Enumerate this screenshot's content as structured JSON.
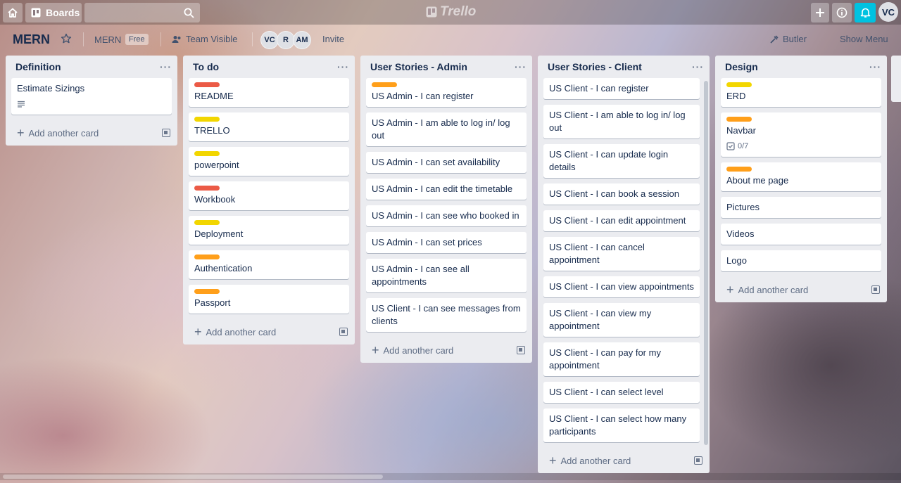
{
  "header": {
    "boards_label": "Boards",
    "logo_text": "Trello",
    "avatar_initials": "VC"
  },
  "board": {
    "title": "MERN",
    "team_name": "MERN",
    "plan_badge": "Free",
    "visibility": "Team Visible",
    "members": [
      "VC",
      "R",
      "AM"
    ],
    "invite_label": "Invite",
    "butler_label": "Butler",
    "show_menu_label": "Show Menu"
  },
  "labels": {
    "red": "#eb5a46",
    "yellow": "#f2d600",
    "orange": "#ff9f1a"
  },
  "add_card_label": "Add another card",
  "list_menu_glyph": "···",
  "lists": [
    {
      "title": "Definition",
      "cards": [
        {
          "text": "Estimate Sizings",
          "has_description": true
        }
      ]
    },
    {
      "title": "To do",
      "cards": [
        {
          "text": "README",
          "label": "red"
        },
        {
          "text": "TRELLO",
          "label": "yellow"
        },
        {
          "text": "powerpoint",
          "label": "yellow"
        },
        {
          "text": "Workbook",
          "label": "red"
        },
        {
          "text": "Deployment",
          "label": "yellow"
        },
        {
          "text": "Authentication",
          "label": "orange"
        },
        {
          "text": "Passport",
          "label": "orange"
        }
      ]
    },
    {
      "title": "User Stories - Admin",
      "cards": [
        {
          "text": "US Admin - I can register",
          "label": "orange"
        },
        {
          "text": "US Admin - I am able to log in/ log out"
        },
        {
          "text": "US Admin - I can set availability"
        },
        {
          "text": "US Admin - I can edit the timetable"
        },
        {
          "text": "US Admin - I can see who booked in"
        },
        {
          "text": "US Admin - I can set prices"
        },
        {
          "text": "US Admin - I can see all appointments"
        },
        {
          "text": "US Client - I can see messages from clients"
        }
      ]
    },
    {
      "title": "User Stories - Client",
      "cards": [
        {
          "text": "US Client - I can register"
        },
        {
          "text": "US Client - I am able to log in/ log out"
        },
        {
          "text": "US Client - I can update login details"
        },
        {
          "text": "US Client - I can book a session"
        },
        {
          "text": "US Client - I can edit appointment"
        },
        {
          "text": "US Client - I can cancel appointment"
        },
        {
          "text": "US Client - I can view appointments"
        },
        {
          "text": "US Client - I can view my appointment"
        },
        {
          "text": "US Client - I can pay for my appointment"
        },
        {
          "text": "US Client - I can select level"
        },
        {
          "text": "US Client - I can select how many participants"
        }
      ]
    },
    {
      "title": "Design",
      "cards": [
        {
          "text": "ERD",
          "label": "yellow"
        },
        {
          "text": "Navbar",
          "label": "orange",
          "checklist": "0/7"
        },
        {
          "text": "About me page",
          "label": "orange"
        },
        {
          "text": "Pictures"
        },
        {
          "text": "Videos"
        },
        {
          "text": "Logo"
        }
      ]
    }
  ]
}
